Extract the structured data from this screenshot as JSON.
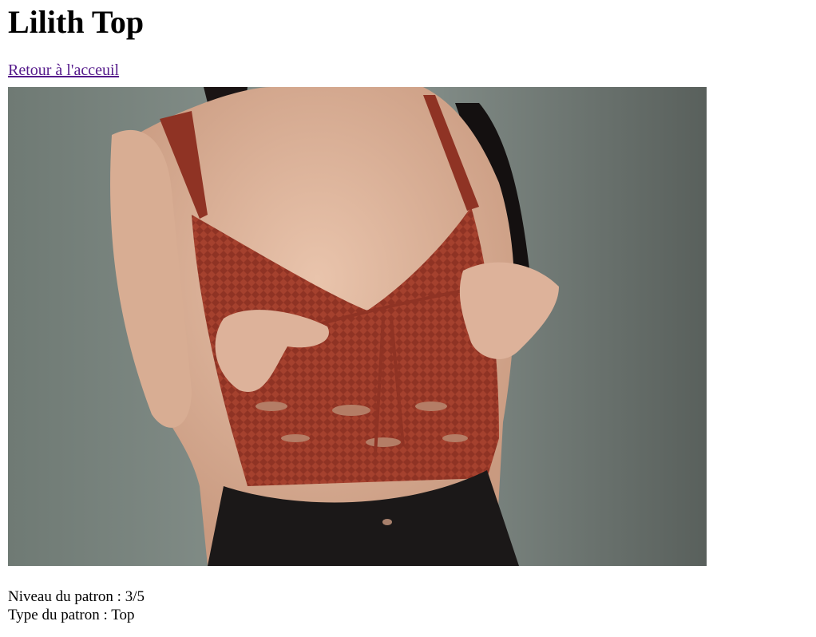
{
  "page": {
    "title": "Lilith Top",
    "back_link": "Retour à l'acceuil"
  },
  "image": {
    "subject": "crocheted rust-red tie-front bralette top modeled against a gray-green wall"
  },
  "details": {
    "level_label": "Niveau du patron : ",
    "level_value": "3/5",
    "type_label": "Type du patron : ",
    "type_value": "Top"
  }
}
